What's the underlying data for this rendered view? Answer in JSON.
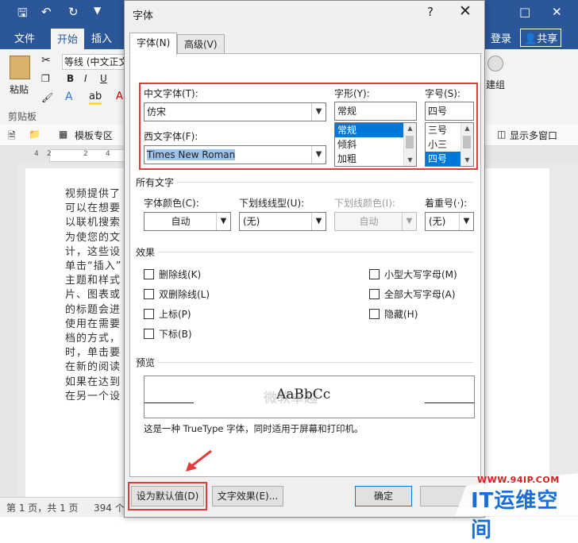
{
  "word": {
    "tabs": [
      "文件",
      "开始",
      "插入"
    ],
    "right_tabs": {
      "login": "登录",
      "share": "共享"
    },
    "font_box": "等线 (中文正文",
    "groups": {
      "paste": "粘贴",
      "clipboard": "剪贴板",
      "create_group": "建组"
    },
    "format_buttons": [
      "B",
      "I",
      "U"
    ],
    "toolbar2": {
      "template": "模板专区",
      "multiwindow": "显示多窗口"
    },
    "ruler_ticks": [
      "4",
      "2",
      "2",
      "4"
    ],
    "document_lines": [
      "视频提供了",
      "可以在想要",
      "以联机搜索",
      "为使您的文",
      "计，这些设",
      "单击“插入”",
      "主题和样式",
      "片、图表或",
      "的标题会进",
      "使用在需要",
      "档的方式，",
      "时，单击要",
      "在新的阅读",
      "如果在达到",
      "在另一个设"
    ],
    "status": {
      "page": "第 1 页，共 1 页",
      "words": "394 个"
    }
  },
  "dialog": {
    "title": "字体",
    "help": "?",
    "tabs": [
      {
        "label": "字体(N)"
      },
      {
        "label": "高级(V)"
      }
    ],
    "chinese_font": {
      "label": "中文字体(T):",
      "value": "仿宋"
    },
    "western_font": {
      "label": "西文字体(F):",
      "value": "Times New Roman"
    },
    "style": {
      "label": "字形(Y):",
      "value": "常规",
      "options": [
        "常规",
        "倾斜",
        "加粗"
      ]
    },
    "size": {
      "label": "字号(S):",
      "value": "四号",
      "options": [
        "三号",
        "小三",
        "四号"
      ]
    },
    "all_text": {
      "heading": "所有文字",
      "font_color": {
        "label": "字体颜色(C):",
        "value": "自动"
      },
      "underline_style": {
        "label": "下划线线型(U):",
        "value": "(无)"
      },
      "underline_color": {
        "label": "下划线颜色(I):",
        "value": "自动"
      },
      "emphasis": {
        "label": "着重号(·):",
        "value": "(无)"
      }
    },
    "effects": {
      "heading": "效果",
      "left": [
        "删除线(K)",
        "双删除线(L)",
        "上标(P)",
        "下标(B)"
      ],
      "right": [
        "小型大写字母(M)",
        "全部大写字母(A)",
        "隐藏(H)"
      ]
    },
    "preview": {
      "heading": "预览",
      "sample": "AaBbCc",
      "sample_cn": "微软卓越"
    },
    "note": "这是一种 TrueType 字体，同时适用于屏幕和打印机。",
    "buttons": {
      "set_default": "设为默认值(D)",
      "text_effects": "文字效果(E)...",
      "ok": "确定"
    }
  },
  "watermark": {
    "url": "WWW.94IP.COM",
    "logo": "IT运维空间"
  },
  "colors": {
    "word_blue": "#2b579a",
    "highlight": "#0078d7",
    "annotation_red": "#e23b3b"
  }
}
